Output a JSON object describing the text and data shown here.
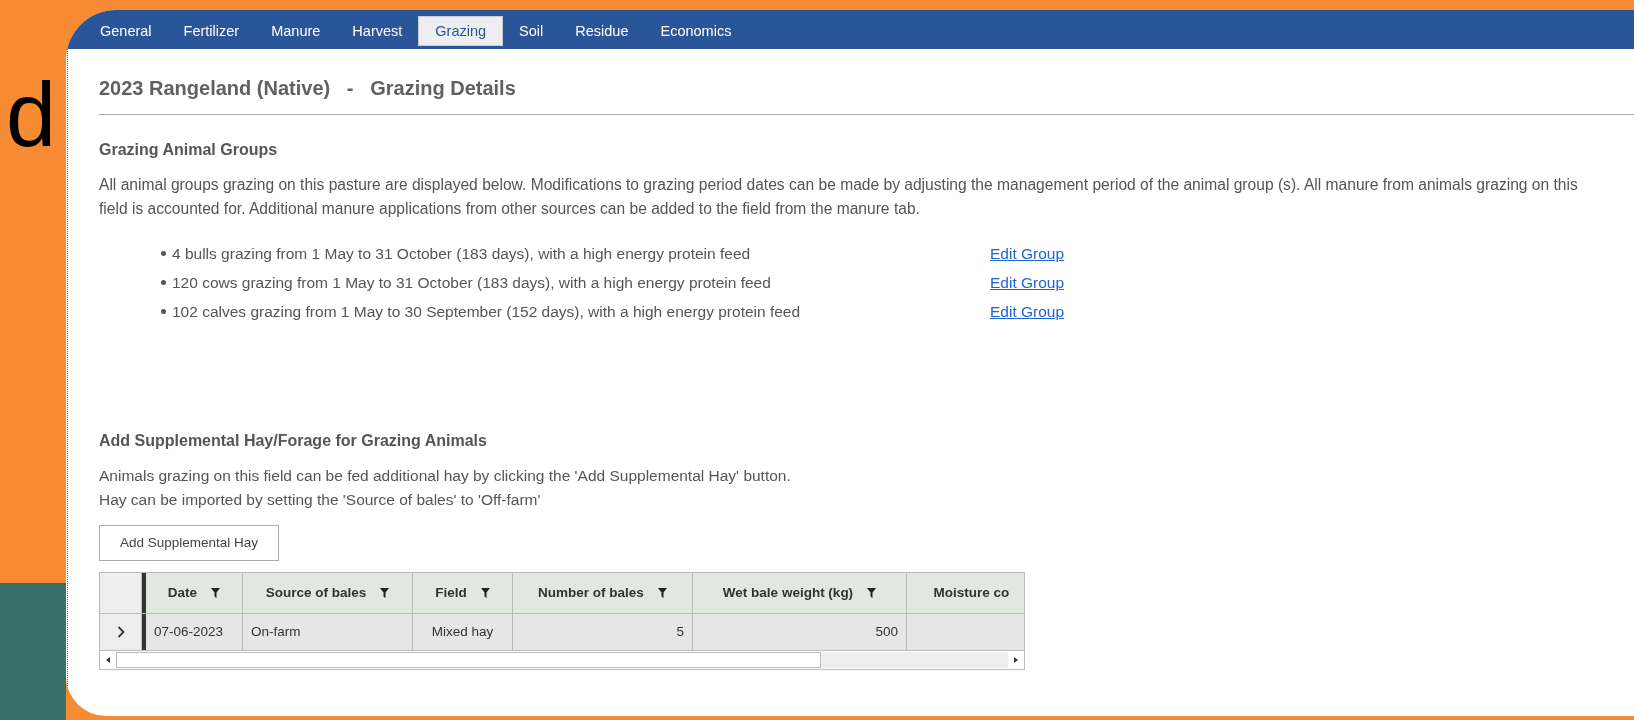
{
  "backdrop": {
    "letter": "d"
  },
  "tabs": [
    {
      "label": "General",
      "selected": false
    },
    {
      "label": "Fertilizer",
      "selected": false
    },
    {
      "label": "Manure",
      "selected": false
    },
    {
      "label": "Harvest",
      "selected": false
    },
    {
      "label": "Grazing",
      "selected": true
    },
    {
      "label": "Soil",
      "selected": false
    },
    {
      "label": "Residue",
      "selected": false
    },
    {
      "label": "Economics",
      "selected": false
    }
  ],
  "page_title": "2023 Rangeland (Native)   -   Grazing Details",
  "animal_groups": {
    "heading": "Grazing Animal Groups",
    "description": "All animal groups grazing on this pasture are displayed below. Modifications to grazing period dates can be made by adjusting the management period of the animal group (s). All manure from animals grazing on this field is accounted for. Additional manure applications from other sources can be added to the field from the manure tab.",
    "groups": [
      {
        "text": "4 bulls grazing from 1 May to 31 October (183 days), with a high energy protein feed",
        "link": "Edit Group"
      },
      {
        "text": "120 cows grazing from 1 May to 31 October (183 days), with a high energy protein feed",
        "link": "Edit Group"
      },
      {
        "text": "102 calves grazing from 1 May to 30 September (152 days), with a high energy protein feed",
        "link": "Edit Group"
      }
    ]
  },
  "supplemental": {
    "heading": "Add Supplemental Hay/Forage for Grazing Animals",
    "lines": [
      "Animals grazing on this field can be fed additional hay by clicking the 'Add Supplemental Hay' button.",
      "Hay can be imported by setting the 'Source of bales' to 'Off-farm'"
    ],
    "button": "Add Supplemental Hay"
  },
  "table": {
    "columns": [
      {
        "label": "Date",
        "filter": true
      },
      {
        "label": "Source of bales",
        "filter": true
      },
      {
        "label": "Field",
        "filter": true
      },
      {
        "label": "Number of bales",
        "filter": true
      },
      {
        "label": "Wet bale weight (kg)",
        "filter": true
      },
      {
        "label": "Moisture co",
        "filter": false
      }
    ],
    "rows": [
      {
        "cells": [
          "07-06-2023",
          "On-farm",
          "Mixed hay",
          "5",
          "500"
        ]
      }
    ]
  }
}
